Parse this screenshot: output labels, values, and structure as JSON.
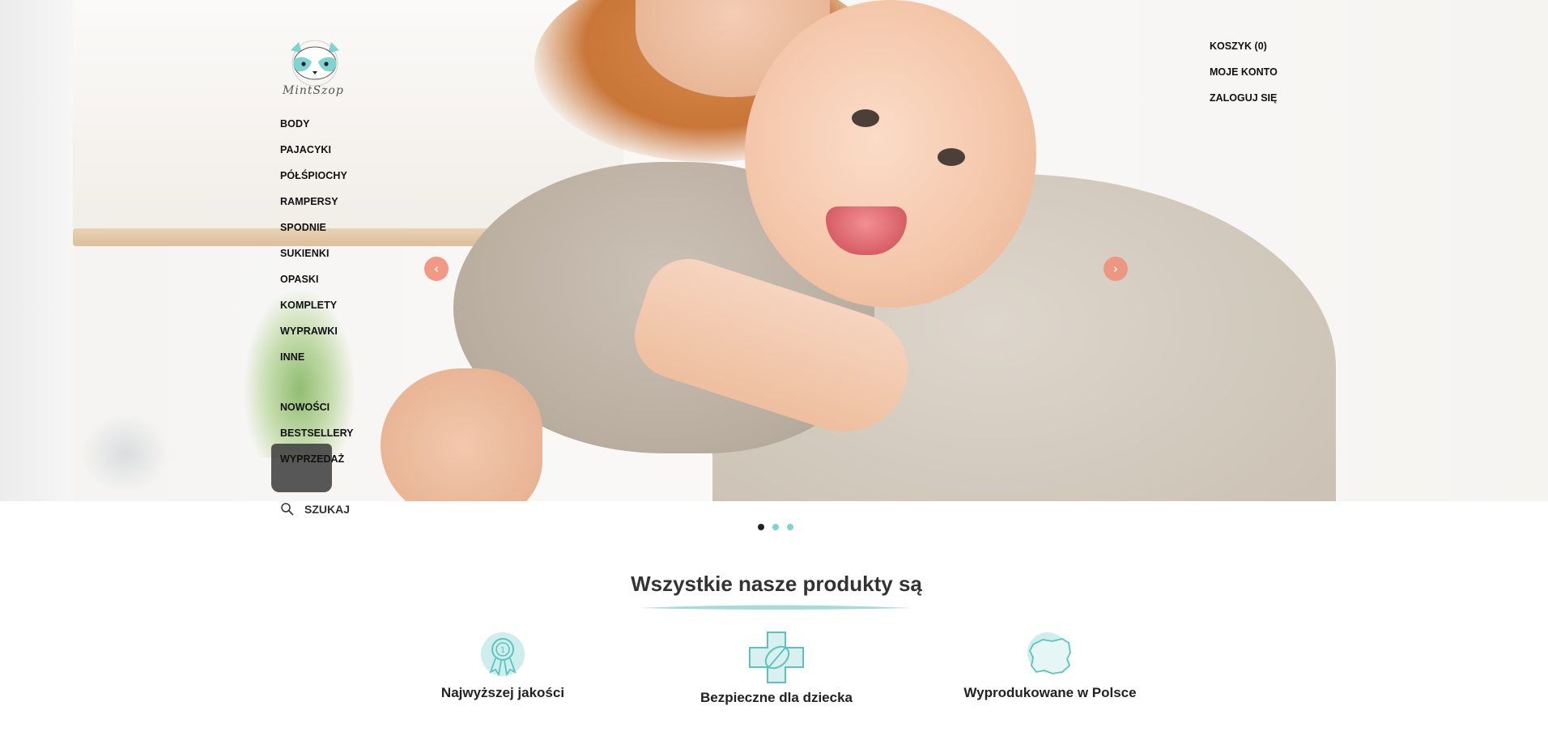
{
  "brand": {
    "logo_text": "MintSzop"
  },
  "hero": {
    "background": "photo: smiling baby held by mother",
    "prev_label": "‹",
    "next_label": "›",
    "slides_count": 3,
    "active_slide": 1
  },
  "nav": {
    "categories": [
      "BODY",
      "PAJACYKI",
      "PÓŁŚPIOCHY",
      "RAMPERSY",
      "SPODNIE",
      "SUKIENKI",
      "OPASKI",
      "KOMPLETY",
      "WYPRAWKI",
      "INNE"
    ],
    "featured": [
      "NOWOŚCI",
      "BESTSELLERY",
      "WYPRZEDAŻ"
    ],
    "search_label": "SZUKAJ"
  },
  "user_nav": {
    "cart": "KOSZYK (0)",
    "account": "MOJE KONTO",
    "login": "ZALOGUJ SIĘ"
  },
  "features": {
    "title": "Wszystkie nasze produkty są",
    "items": [
      {
        "icon": "award-ribbon-icon",
        "label": "Najwyższej jakości"
      },
      {
        "icon": "leaf-cross-icon",
        "label": "Bezpieczne dla dziecka"
      },
      {
        "icon": "poland-map-icon",
        "label": "Wyprodukowane w Polsce"
      }
    ]
  },
  "colors": {
    "accent_mint": "#7fd3d0",
    "arrow_coral": "#f0917a"
  }
}
